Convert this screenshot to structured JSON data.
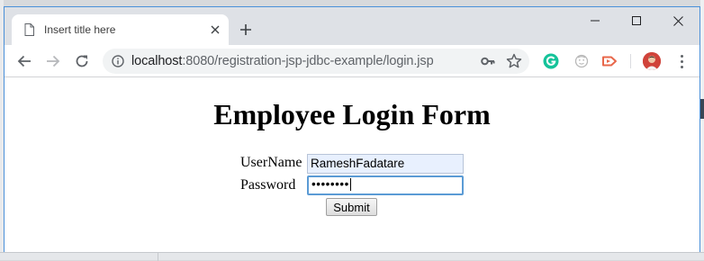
{
  "browser": {
    "tab": {
      "title": "Insert title here"
    },
    "address_bar": {
      "host": "localhost",
      "path": ":8080/registration-jsp-jdbc-example/login.jsp"
    }
  },
  "page": {
    "heading": "Employee Login Form",
    "form": {
      "username_label": "UserName",
      "username_value": "RameshFadatare",
      "password_label": "Password",
      "password_value": "••••••••",
      "submit_label": "Submit"
    }
  },
  "colors": {
    "window_border": "#4a90d9",
    "titlebar": "#dee1e6",
    "omnibox": "#f1f3f4",
    "autofill": "#e8f0fe",
    "focus_ring": "#5b9bd5"
  },
  "icons": {
    "tab": "document-icon",
    "tab_close": "close-icon",
    "new_tab": "plus-icon",
    "back": "arrow-left-icon",
    "forward": "arrow-right-icon",
    "reload": "reload-icon",
    "site_info": "info-icon",
    "password": "key-icon",
    "bookmark": "star-icon",
    "extensions": [
      "grammarly-icon",
      "face-icon",
      "tag-icon"
    ],
    "profile": "avatar",
    "menu": "more-vertical-icon"
  }
}
